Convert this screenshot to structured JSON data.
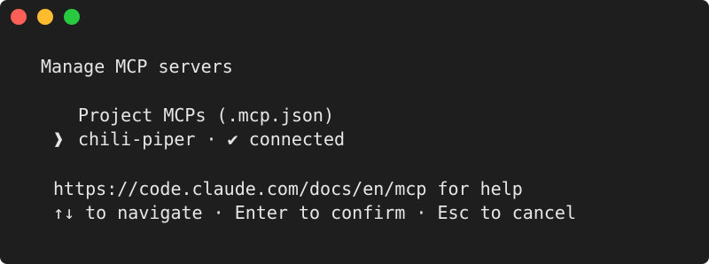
{
  "window": {
    "controls": [
      {
        "name": "close",
        "color": "#fe5f57"
      },
      {
        "name": "minimize",
        "color": "#febc2e"
      },
      {
        "name": "maximize",
        "color": "#28c840"
      }
    ]
  },
  "terminal": {
    "title": "Manage MCP servers",
    "section_label": "Project MCPs (.mcp.json)",
    "selected_pointer": "❱",
    "server": {
      "name": "chili-piper",
      "separator": "·",
      "status_icon": "✔",
      "status_text": "connected"
    },
    "help_text": "https://code.claude.com/docs/en/mcp for help",
    "hint_text": "↑↓ to navigate · Enter to confirm · Esc to cancel"
  }
}
